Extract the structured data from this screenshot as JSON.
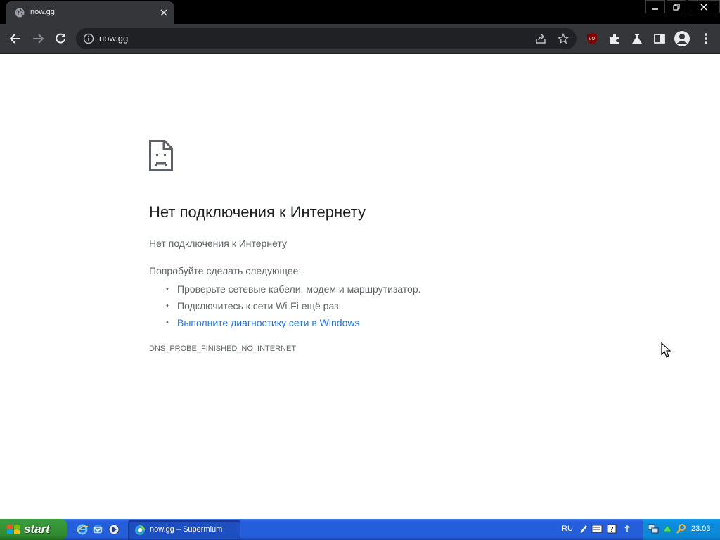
{
  "browser": {
    "tab_title": "now.gg",
    "url": "now.gg",
    "accent_color": "#35363a"
  },
  "error": {
    "heading": "Нет подключения к Интернету",
    "subheading": "Нет подключения к Интернету",
    "try_label": "Попробуйте сделать следующее:",
    "suggestions": [
      "Проверьте сетевые кабели, модем и маршрутизатор.",
      "Подключитесь к сети Wi-Fi ещё раз."
    ],
    "diagnostics_link": "Выполните диагностику сети в Windows",
    "code": "DNS_PROBE_FINISHED_NO_INTERNET"
  },
  "taskbar": {
    "start_label": "start",
    "task_label": "now.gg – Supermium",
    "language": "RU",
    "clock": "23:03"
  },
  "icons": {
    "tab": "globe-icon",
    "toolbar": [
      "back-icon",
      "forward-icon",
      "reload-icon",
      "info-icon",
      "share-icon",
      "star-icon",
      "ublock-icon",
      "extensions-icon",
      "labs-icon",
      "sidepanel-icon",
      "profile-icon",
      "menu-icon"
    ]
  }
}
